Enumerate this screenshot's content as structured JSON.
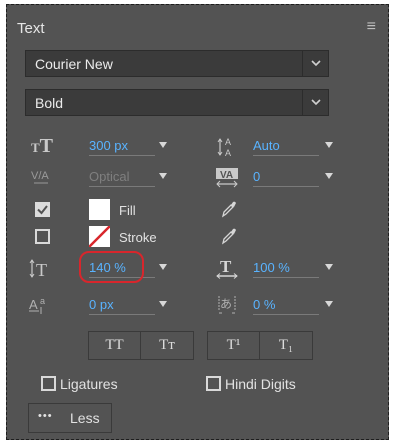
{
  "panel": {
    "title": "Text",
    "menu_icon": "≡"
  },
  "font": {
    "family": "Courier New",
    "style": "Bold"
  },
  "size": {
    "value": "300 px"
  },
  "leading_auto": {
    "value": "Auto"
  },
  "kerning": {
    "value": "Optical"
  },
  "tracking": {
    "value": "0"
  },
  "fill": {
    "label": "Fill",
    "checked": true
  },
  "stroke": {
    "label": "Stroke",
    "checked": false
  },
  "vertical_scale": {
    "value": "140 %"
  },
  "horizontal_scale": {
    "value": "100 %"
  },
  "baseline_shift": {
    "value": "0 px"
  },
  "tsume": {
    "value": "0 %"
  },
  "type_buttons": {
    "all_caps": "TT",
    "small_caps": "Tт",
    "superscript": "T¹",
    "subscript": "T₁"
  },
  "options": {
    "ligatures": "Ligatures",
    "hindi_digits": "Hindi Digits"
  },
  "less_button": {
    "dots": "•••",
    "label": "Less"
  },
  "colors": {
    "panel_bg": "#535353",
    "value_blue": "#59b3ff",
    "highlight_red": "#d8262c",
    "stroke_swatch_line": "#d8262c"
  },
  "icons": {
    "size": "font-size-icon",
    "leading": "leading-icon",
    "kerning": "kerning-icon",
    "tracking": "tracking-icon",
    "fill_picker": "eyedropper-icon",
    "stroke_picker": "eyedropper-icon",
    "vscale": "vertical-scale-icon",
    "hscale": "horizontal-scale-icon",
    "baseline": "baseline-shift-icon",
    "tsume": "tsume-icon"
  }
}
